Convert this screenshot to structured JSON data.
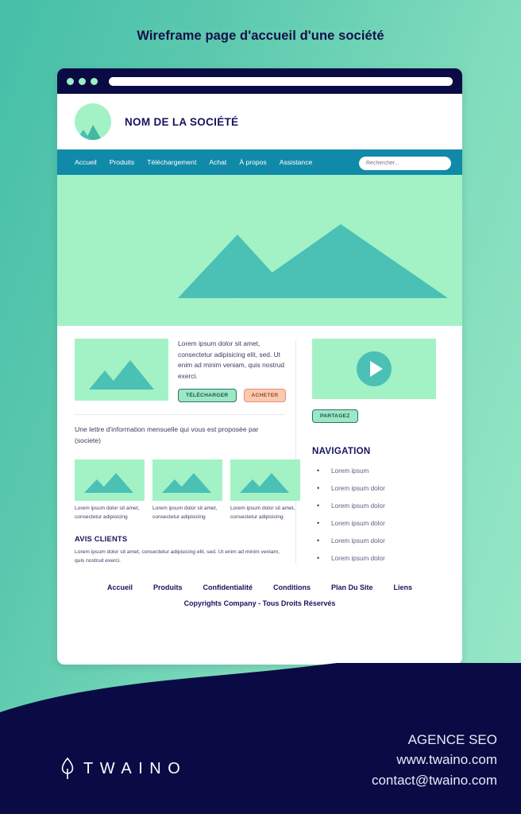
{
  "poster": {
    "title": "Wireframe page d'accueil d'une société"
  },
  "browser": {
    "dots": [
      "window-dot-1",
      "window-dot-2",
      "window-dot-3"
    ],
    "address_value": ""
  },
  "site_header": {
    "logo_icon": "mountain-logo-icon",
    "company_name": "NOM DE LA SOCIÉTÉ"
  },
  "navbar": {
    "links": [
      {
        "label": "Accueil"
      },
      {
        "label": "Produits"
      },
      {
        "label": "Téléchargement"
      },
      {
        "label": "Achat"
      },
      {
        "label": "À propos"
      },
      {
        "label": "Assistance"
      }
    ],
    "search": {
      "placeholder": "Rechercher...",
      "value": ""
    }
  },
  "hero": {
    "image_icon": "mountain-banner-icon"
  },
  "promo": {
    "image_icon": "mountain-image-icon",
    "text": "Lorem ipsum dolor sit amet, consectetur adipisicing elit, sed. Ut enim ad minim veniam, quis nostrud exerci.",
    "download_label": "TÉLÉCHARGER",
    "buy_label": "ACHETER"
  },
  "newsletter": {
    "text": "Une lettre d'information mensuelle qui vous est proposée par (societe)"
  },
  "cards": [
    {
      "image_icon": "mountain-image-icon",
      "caption": "Lorem ipsum dolor sit amet, consectetur adipisicing"
    },
    {
      "image_icon": "mountain-image-icon",
      "caption": "Lorem ipsum dolor sit amet, consectetur adipisicing"
    },
    {
      "image_icon": "mountain-image-icon",
      "caption": "Lorem ipsum dolor sit amet, consectetur adipisicing"
    }
  ],
  "avis": {
    "title": "AVIS CLIENTS",
    "text": "Lorem ipsum dolor sit amet, consectetur adipisicing elit, sed. Ut enim ad minim veniam, quis nostrud exerci."
  },
  "video": {
    "play_icon": "play-button-icon",
    "share_label": "PARTAGEZ"
  },
  "navigation": {
    "title": "NAVIGATION",
    "items": [
      {
        "label": "Lorem ipsum"
      },
      {
        "label": "Lorem ipsum dolor"
      },
      {
        "label": "Lorem ipsum dolor"
      },
      {
        "label": "Lorem ipsum dolor"
      },
      {
        "label": "Lorem ipsum dolor"
      },
      {
        "label": "Lorem ipsum dolor"
      }
    ]
  },
  "footer": {
    "links": [
      {
        "label": "Accueil"
      },
      {
        "label": "Produits"
      },
      {
        "label": "Confidentialité"
      },
      {
        "label": "Conditions"
      },
      {
        "label": "Plan Du Site"
      },
      {
        "label": "Liens"
      }
    ],
    "copyright": "Copyrights Company - Tous Droits Réservés"
  },
  "brand": {
    "logo_icon": "twaino-leaf-icon",
    "name": "TWAINO",
    "tagline": "AGENCE SEO",
    "website": "www.twaino.com",
    "email": "contact@twaino.com"
  },
  "colors": {
    "background_start": "#45BFA8",
    "background_end": "#9BE9C8",
    "navy": "#0A0B45",
    "nav_bar": "#108AA8",
    "mint": "#A2F2C6",
    "teal": "#4BC0B5",
    "peach": "#FBC9AE",
    "text_navy": "#171360"
  }
}
